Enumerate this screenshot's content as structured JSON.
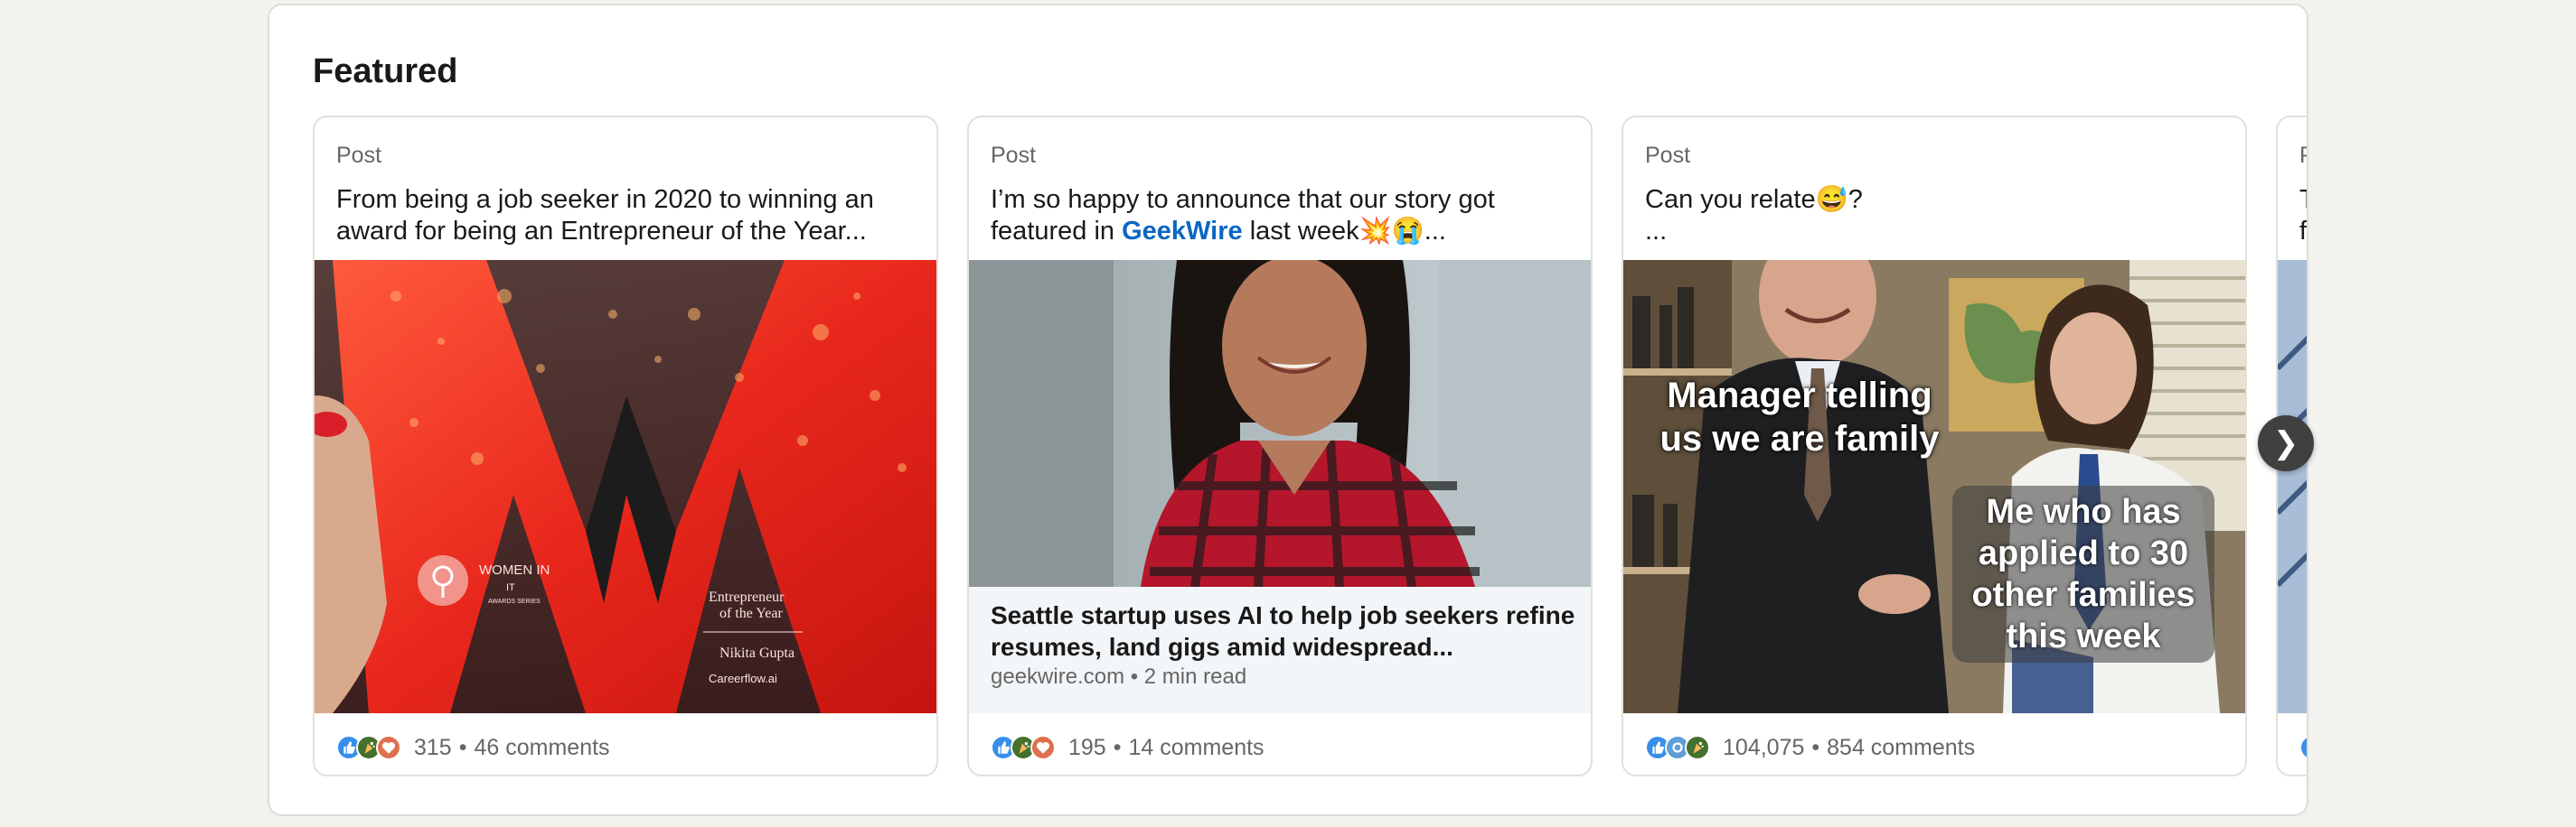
{
  "featured": {
    "title": "Featured",
    "cards": [
      {
        "label": "Post",
        "text": "From being a job seeker in 2020 to winning an award for being an Entrepreneur of the Year...",
        "image_text": {
          "brand": "WOMEN IN",
          "brand2": "IT",
          "brand3": "AWARDS SERIES",
          "award": "Entrepreneur of the Year",
          "name": "Nikita Gupta",
          "company": "Careerflow.ai"
        },
        "reactions": [
          "like-icon",
          "celebrate-icon",
          "love-icon"
        ],
        "reaction_count": "315",
        "comments": "46 comments"
      },
      {
        "label": "Post",
        "text_pre": "I’m so happy to announce that our story got featured in ",
        "text_link": "GeekWire",
        "text_post": " last week💥😭...",
        "link_title": "Seattle startup uses AI to help job seekers refine resumes, land gigs amid widespread...",
        "link_meta": "geekwire.com • 2 min read",
        "reactions": [
          "like-icon",
          "celebrate-icon",
          "love-icon"
        ],
        "reaction_count": "195",
        "comments": "14 comments"
      },
      {
        "label": "Post",
        "text": "Can you relate😅?\n...",
        "meme_caption_top": "Manager telling us we are family",
        "meme_caption_bottom": "Me who has applied to 30 other families this week",
        "reactions": [
          "like-icon",
          "support-icon",
          "celebrate-icon"
        ],
        "reaction_count": "104,075",
        "comments": "854 comments"
      },
      {
        "label": "P",
        "text_line1": "T",
        "text_line2": "fr"
      }
    ]
  },
  "next_button": "❯",
  "dot": "•",
  "colors": {
    "accent": "#0a66c2",
    "like": "#378fe9",
    "celebrate": "#44712e",
    "love": "#df704d"
  }
}
